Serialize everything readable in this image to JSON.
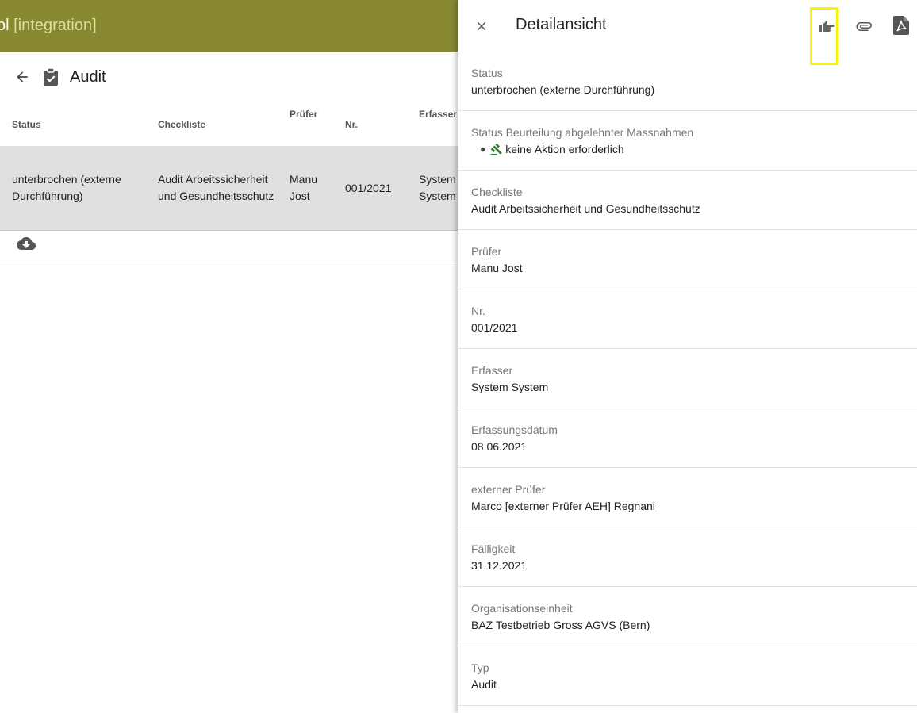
{
  "app": {
    "title_prefix": "ol",
    "env": "[integration]"
  },
  "page": {
    "title": "Audit"
  },
  "table": {
    "headers": {
      "status": "Status",
      "checkliste": "Checkliste",
      "pruefer": "Prüfer",
      "nr": "Nr.",
      "erfasser": "Erfasser"
    },
    "row": {
      "status": "unterbrochen (externe Durchführung)",
      "checkliste": "Audit Arbeitssicherheit und Gesundheitsschutz",
      "pruefer": "Manu Jost",
      "nr": "001/2021",
      "erfasser": "System System"
    }
  },
  "panel": {
    "title": "Detailansicht",
    "fields": [
      {
        "label": "Status",
        "value": "unterbrochen (externe Durchführung)"
      },
      {
        "label": "Status Beurteilung abgelehnter Massnahmen",
        "value": "keine Aktion erforderlich"
      },
      {
        "label": "Checkliste",
        "value": "Audit Arbeitssicherheit und Gesundheitsschutz"
      },
      {
        "label": "Prüfer",
        "value": "Manu Jost"
      },
      {
        "label": "Nr.",
        "value": "001/2021"
      },
      {
        "label": "Erfasser",
        "value": "System System"
      },
      {
        "label": "Erfassungsdatum",
        "value": "08.06.2021"
      },
      {
        "label": "externer Prüfer",
        "value": "Marco [externer Prüfer AEH] Regnani"
      },
      {
        "label": "Fälligkeit",
        "value": "31.12.2021"
      },
      {
        "label": "Organisationseinheit",
        "value": "BAZ Testbetrieb Gross AGVS (Bern)"
      },
      {
        "label": "Typ",
        "value": "Audit"
      }
    ]
  },
  "icons": {
    "back": "arrow-back-icon",
    "clipboard": "clipboard-check-icon",
    "download": "cloud-download-icon",
    "close": "close-icon",
    "hand": "hand-pointing-icon",
    "attachment": "paperclip-icon",
    "pdf": "pdf-file-icon",
    "gavel": "gavel-icon"
  },
  "colors": {
    "app_bar": "#888830",
    "row_selected": "#e0e0e0",
    "highlight": "#f5f500",
    "gavel": "#2e7d32"
  }
}
